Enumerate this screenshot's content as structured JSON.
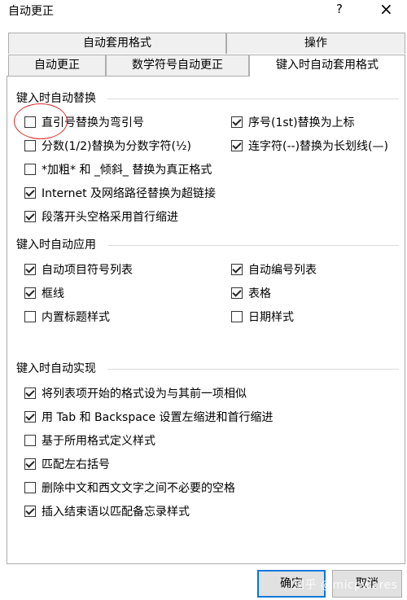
{
  "window": {
    "title": "自动更正",
    "help": "?",
    "close": "×"
  },
  "tabs": {
    "row1": [
      "自动套用格式",
      "操作"
    ],
    "row2": [
      "自动更正",
      "数学符号自动更正",
      "键入时自动套用格式"
    ]
  },
  "sections": {
    "replace": {
      "title": "键入时自动替换",
      "left": [
        {
          "label": "直引号替换为弯引号",
          "checked": false
        },
        {
          "label": "分数(1/2)替换为分数字符(½)",
          "checked": false
        },
        {
          "label": "*加粗* 和 _倾斜_ 替换为真正格式",
          "checked": false
        },
        {
          "label": "Internet 及网络路径替换为超链接",
          "checked": true
        },
        {
          "label": "段落开头空格采用首行缩进",
          "checked": true
        }
      ],
      "right": [
        {
          "label": "序号(1st)替换为上标",
          "checked": true
        },
        {
          "label": "连字符(--)替换为长划线(—)",
          "checked": true
        }
      ]
    },
    "apply": {
      "title": "键入时自动应用",
      "left": [
        {
          "label": "自动项目符号列表",
          "checked": true
        },
        {
          "label": "框线",
          "checked": true
        },
        {
          "label": "内置标题样式",
          "checked": false
        }
      ],
      "right": [
        {
          "label": "自动编号列表",
          "checked": true
        },
        {
          "label": "表格",
          "checked": true
        },
        {
          "label": "日期样式",
          "checked": false
        }
      ]
    },
    "auto": {
      "title": "键入时自动实现",
      "items": [
        {
          "label": "将列表项开始的格式设为与其前一项相似",
          "checked": true
        },
        {
          "label": "用 Tab 和 Backspace 设置左缩进和首行缩进",
          "checked": true
        },
        {
          "label": "基于所用格式定义样式",
          "checked": false
        },
        {
          "label": "匹配左右括号",
          "checked": true
        },
        {
          "label": "删除中文和西文文字之间不必要的空格",
          "checked": false
        },
        {
          "label": "插入结束语以匹配备忘录样式",
          "checked": true
        }
      ]
    }
  },
  "buttons": {
    "ok": "确定",
    "cancel": "取消"
  },
  "watermark": "知乎 @micpwares"
}
